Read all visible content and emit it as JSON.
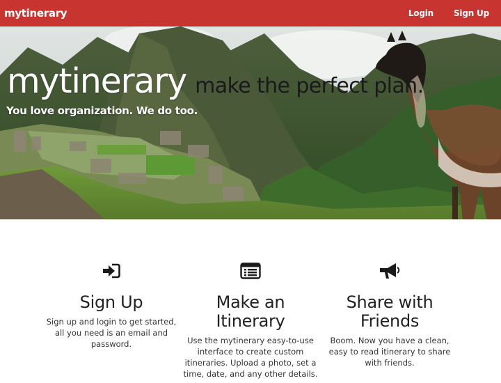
{
  "navbar": {
    "brand": "mytinerary",
    "links": [
      {
        "label": "Login"
      },
      {
        "label": "Sign Up"
      }
    ],
    "color": "#c8342f"
  },
  "hero": {
    "title": "mytinerary",
    "tagline": "make the perfect plan.",
    "subtitle": "You love organization. We do too."
  },
  "features": [
    {
      "icon": "sign-in-icon",
      "title": "Sign Up",
      "text": "Sign up and login to get started, all you need is an email and password."
    },
    {
      "icon": "list-icon",
      "title": "Make an Itinerary",
      "text": "Use the mytinerary easy-to-use interface to create custom itineraries. Upload a photo, set a time, date, and any other details."
    },
    {
      "icon": "bullhorn-icon",
      "title": "Share with Friends",
      "text": "Boom. Now you have a clean, easy to read itinerary to share with friends."
    }
  ]
}
